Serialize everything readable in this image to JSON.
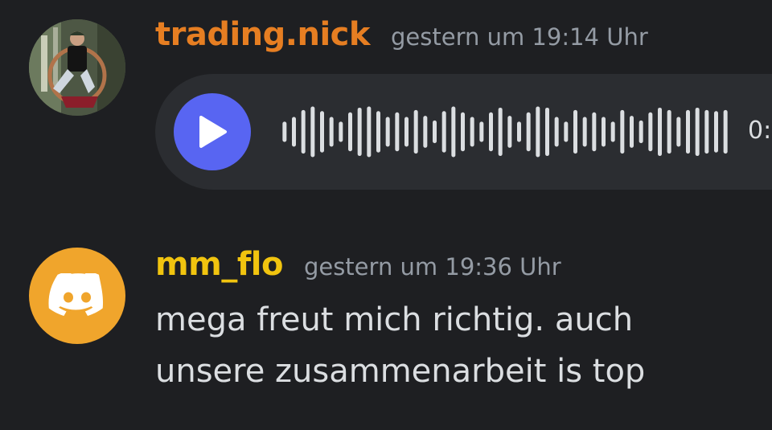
{
  "messages": [
    {
      "username": "trading.nick",
      "username_color": "#e67e22",
      "timestamp": "gestern um 19:14 Uhr",
      "avatar": "user-photo",
      "attachment": {
        "type": "voice-message",
        "icon": "play-icon",
        "duration": "0:",
        "waveform": [
          0.35,
          0.55,
          0.85,
          1.0,
          0.8,
          0.55,
          0.35,
          0.75,
          0.95,
          1.0,
          0.8,
          0.55,
          0.75,
          0.55,
          0.85,
          0.6,
          0.4,
          0.8,
          1.0,
          0.75,
          0.55,
          0.35,
          0.75,
          0.95,
          0.6,
          0.35,
          0.75,
          1.0,
          0.95,
          0.55,
          0.35,
          0.85,
          0.55,
          0.75,
          0.55,
          0.35,
          0.85,
          0.6,
          0.4,
          0.75,
          0.95,
          0.85,
          0.55,
          0.85,
          0.95,
          0.85,
          0.8,
          0.85
        ]
      }
    },
    {
      "username": "mm_flo",
      "username_color": "#f1c40f",
      "timestamp": "gestern um 19:36 Uhr",
      "avatar": "discord-logo",
      "text": "mega freut mich richtig. auch unsere zusammenarbeit is top"
    }
  ],
  "colors": {
    "background": "#1e1f22",
    "voice_bubble": "#2b2d31",
    "play_button": "#5865f2",
    "text": "#dbdee1",
    "timestamp": "#949ba4",
    "waveform": "#dbdee1",
    "discord_avatar_bg": "#f0a52c"
  }
}
